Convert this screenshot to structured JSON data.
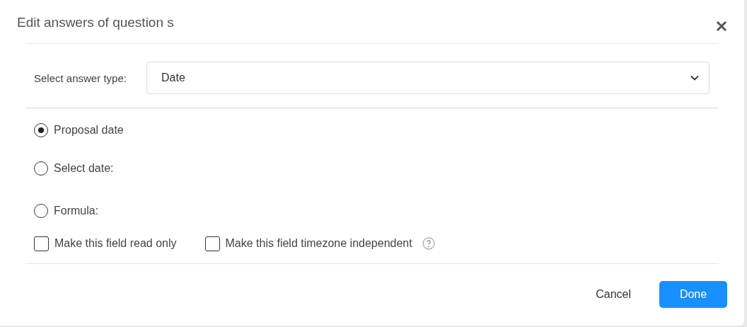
{
  "dialog": {
    "title": "Edit answers of question s"
  },
  "answer_type": {
    "label": "Select answer type:",
    "value": "Date"
  },
  "options": [
    {
      "label": "Proposal date",
      "selected": true
    },
    {
      "label": "Select date:",
      "selected": false
    },
    {
      "label": "Formula:",
      "selected": false
    }
  ],
  "checkboxes": [
    {
      "label": "Make this field read only",
      "checked": false,
      "help": false
    },
    {
      "label": "Make this field timezone independent",
      "checked": false,
      "help": true
    }
  ],
  "buttons": [
    {
      "label": "Cancel",
      "kind": "secondary"
    },
    {
      "label": "Done",
      "kind": "primary"
    }
  ]
}
